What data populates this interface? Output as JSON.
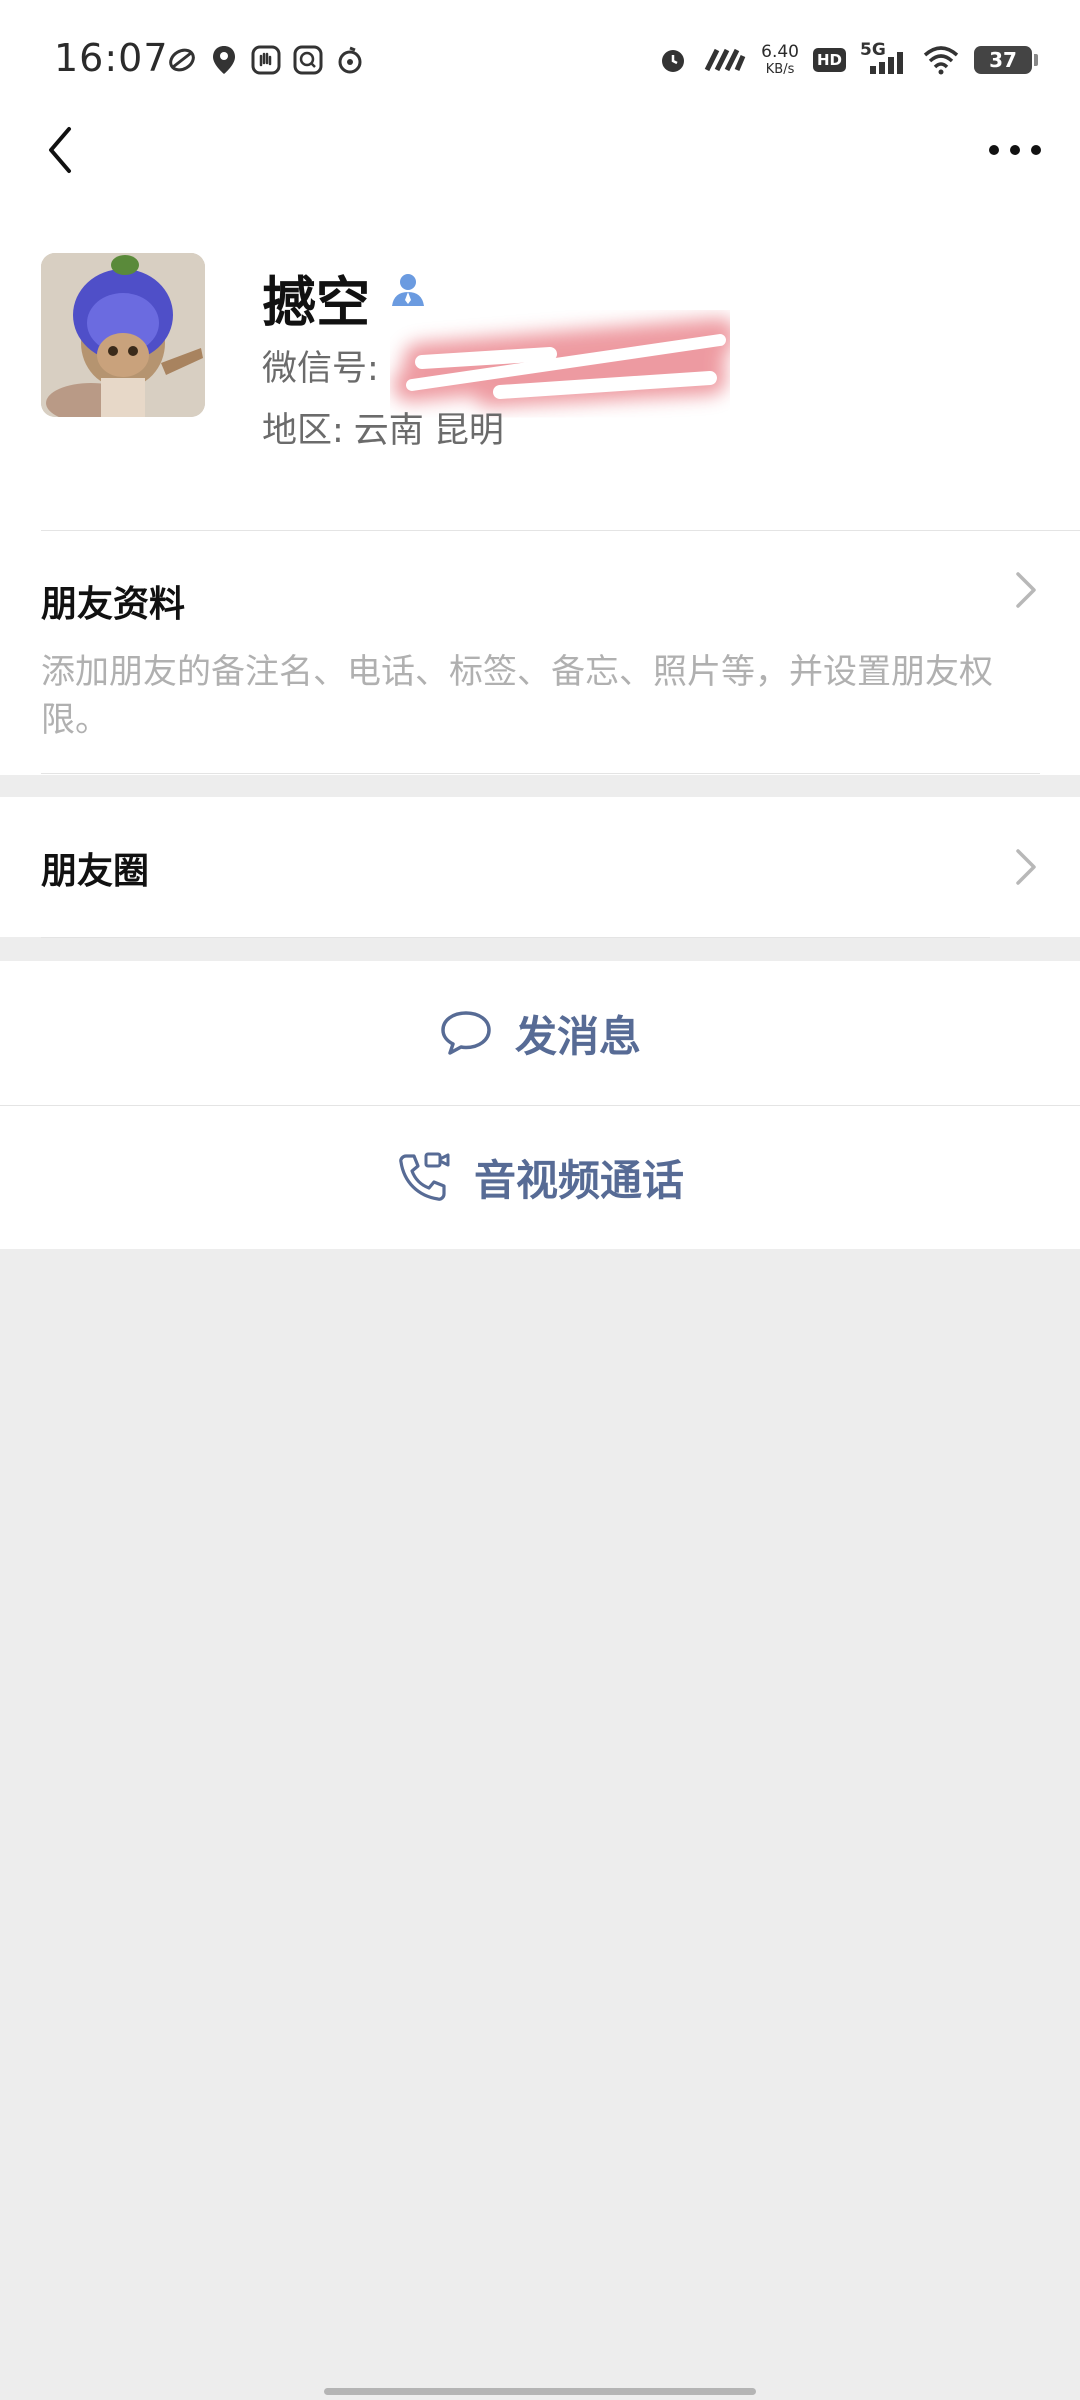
{
  "status_bar": {
    "time": "16:07",
    "net_speed_value": "6.40",
    "net_speed_unit": "KB/s",
    "hd_label": "HD",
    "network_label": "5G",
    "battery_level": "37",
    "left_icons": [
      "app-icon",
      "location-icon",
      "hand-icon",
      "search-app-icon",
      "music-icon"
    ],
    "right_icons": [
      "alarm-icon",
      "nfc-icon",
      "signal-icon",
      "wifi-icon"
    ]
  },
  "nav": {
    "back_icon": "chevron-left-icon",
    "more_icon": "more-dots-icon"
  },
  "profile": {
    "nickname": "撼空",
    "badge_icon": "contact-person-icon",
    "wechat_id_label": "微信号:",
    "wechat_id_value": "",
    "region_label": "地区:",
    "region_province": "云南",
    "region_city": "昆明"
  },
  "friend_info": {
    "title": "朋友资料",
    "description": "添加朋友的备注名、电话、标签、备忘、照片等，并设置朋友权限。"
  },
  "moments": {
    "title": "朋友圈"
  },
  "actions": {
    "send_message": "发消息",
    "av_call": "音视频通话"
  },
  "colors": {
    "link_blue": "#576b95",
    "page_bg": "#ededed",
    "badge_blue": "#6b9be0"
  }
}
